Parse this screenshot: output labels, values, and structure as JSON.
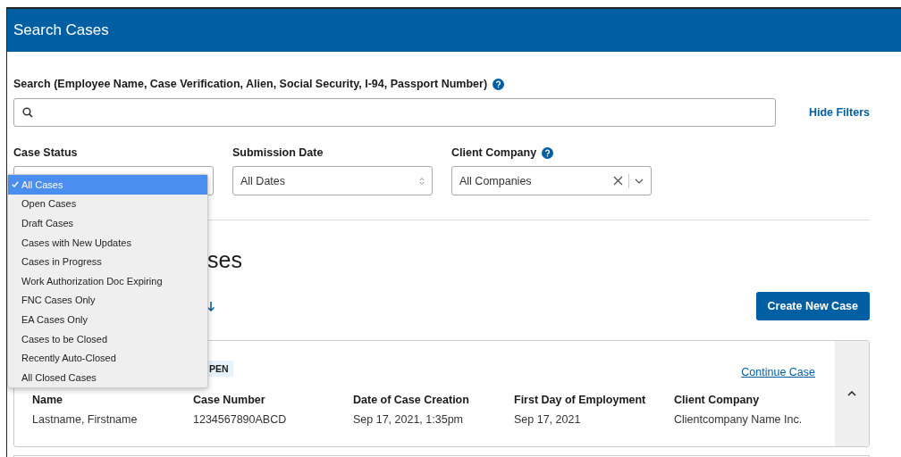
{
  "header": {
    "title": "Search Cases"
  },
  "search": {
    "label": "Search (Employee Name, Case Verification, Alien, Social Security, I-94, Passport Number)",
    "help": true,
    "toggle": "Hide Filters"
  },
  "filters": [
    {
      "kind": "status",
      "label": "Case Status",
      "help": false
    },
    {
      "kind": "date",
      "label": "Submission Date",
      "value": "All Dates",
      "help": false
    },
    {
      "kind": "combo",
      "label": "Client Company",
      "value": "All Companies",
      "help": true
    }
  ],
  "status_options": [
    {
      "label": "All Cases",
      "selected": true
    },
    {
      "label": "Open Cases",
      "selected": false
    },
    {
      "label": "Draft Cases",
      "selected": false
    },
    {
      "label": "Cases with New Updates",
      "selected": false
    },
    {
      "label": "Cases in Progress",
      "selected": false
    },
    {
      "label": "Work Authorization Doc Expiring",
      "selected": false
    },
    {
      "label": "FNC Cases Only",
      "selected": false
    },
    {
      "label": "EA Cases Only",
      "selected": false
    },
    {
      "label": "Cases to be Closed",
      "selected": false
    },
    {
      "label": "Recently Auto-Closed",
      "selected": false
    },
    {
      "label": "All Closed Cases",
      "selected": false
    }
  ],
  "results": {
    "heading": "ses",
    "create_button": "Create New Case"
  },
  "case": {
    "tag": "PEN",
    "action": "Continue Case",
    "expanded": true,
    "fields": [
      {
        "label": "Name",
        "value": "Lastname, Firstname"
      },
      {
        "label": "Case Number",
        "value": "1234567890ABCD"
      },
      {
        "label": "Date of Case Creation",
        "value": "Sep 17, 2021, 1:35pm"
      },
      {
        "label": "First Day of Employment",
        "value": "Sep 17, 2021"
      },
      {
        "label": "Client Company",
        "value": "Clientcompany Name Inc."
      }
    ]
  }
}
